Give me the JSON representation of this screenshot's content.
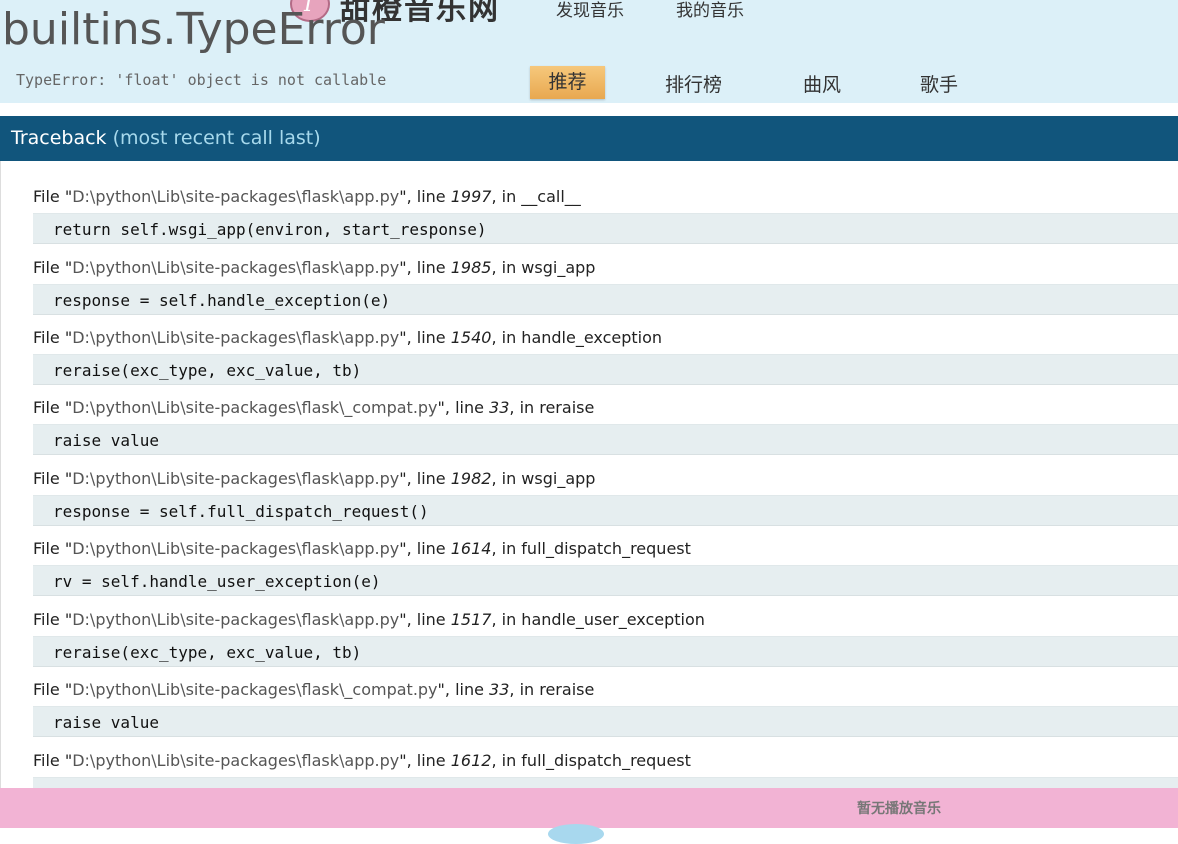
{
  "site": {
    "name": "甜橙音乐网",
    "logo_letter": "T",
    "top_links": [
      "发现音乐",
      "我的音乐"
    ],
    "nav_tabs": [
      "推荐",
      "排行榜",
      "曲风",
      "歌手"
    ]
  },
  "error": {
    "title": "builtins.TypeError",
    "message": "TypeError: 'float' object is not callable"
  },
  "traceback": {
    "header": "Traceback",
    "header_sub": "(most recent call last)",
    "frames": [
      {
        "prefix": "File \"",
        "file": "D:\\python\\Lib\\site-packages\\flask\\app.py",
        "mid": "\", line ",
        "line": "1997",
        "in": ", in ",
        "func": "__call__",
        "code": "return self.wsgi_app(environ, start_response)"
      },
      {
        "prefix": "File \"",
        "file": "D:\\python\\Lib\\site-packages\\flask\\app.py",
        "mid": "\", line ",
        "line": "1985",
        "in": ", in ",
        "func": "wsgi_app",
        "code": "response = self.handle_exception(e)"
      },
      {
        "prefix": "File \"",
        "file": "D:\\python\\Lib\\site-packages\\flask\\app.py",
        "mid": "\", line ",
        "line": "1540",
        "in": ", in ",
        "func": "handle_exception",
        "code": "reraise(exc_type, exc_value, tb)"
      },
      {
        "prefix": "File \"",
        "file": "D:\\python\\Lib\\site-packages\\flask\\_compat.py",
        "mid": "\", line ",
        "line": "33",
        "in": ", in ",
        "func": "reraise",
        "code": "raise value"
      },
      {
        "prefix": "File \"",
        "file": "D:\\python\\Lib\\site-packages\\flask\\app.py",
        "mid": "\", line ",
        "line": "1982",
        "in": ", in ",
        "func": "wsgi_app",
        "code": "response = self.full_dispatch_request()"
      },
      {
        "prefix": "File \"",
        "file": "D:\\python\\Lib\\site-packages\\flask\\app.py",
        "mid": "\", line ",
        "line": "1614",
        "in": ", in ",
        "func": "full_dispatch_request",
        "code": "rv = self.handle_user_exception(e)"
      },
      {
        "prefix": "File \"",
        "file": "D:\\python\\Lib\\site-packages\\flask\\app.py",
        "mid": "\", line ",
        "line": "1517",
        "in": ", in ",
        "func": "handle_user_exception",
        "code": "reraise(exc_type, exc_value, tb)"
      },
      {
        "prefix": "File \"",
        "file": "D:\\python\\Lib\\site-packages\\flask\\_compat.py",
        "mid": "\", line ",
        "line": "33",
        "in": ", in ",
        "func": "reraise",
        "code": "raise value"
      },
      {
        "prefix": "File \"",
        "file": "D:\\python\\Lib\\site-packages\\flask\\app.py",
        "mid": "\", line ",
        "line": "1612",
        "in": ", in ",
        "func": "full_dispatch_request",
        "code": ""
      }
    ]
  },
  "player": {
    "status": "暂无播放音乐"
  },
  "colors": {
    "header_bg": "#dcf0f8",
    "traceback_header_bg": "#11557c",
    "active_tab": "#f0b060",
    "player_bg": "#f2b3d4",
    "code_bg": "#e6eef0"
  }
}
